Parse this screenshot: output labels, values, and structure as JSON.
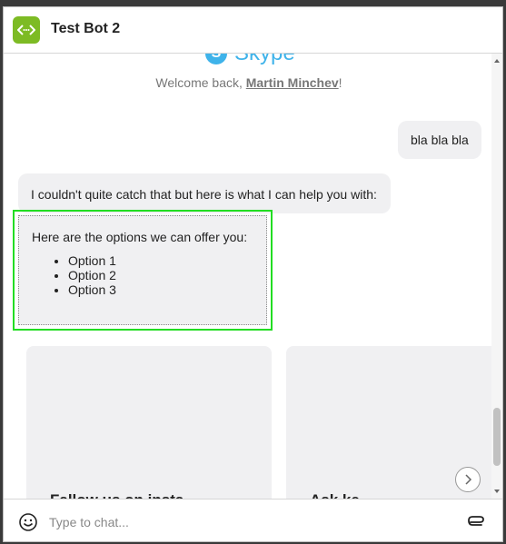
{
  "header": {
    "title": "Test Bot 2"
  },
  "welcome": {
    "brand": "Skype",
    "prefix": "Welcome back, ",
    "user_name": "Martin Minchev",
    "suffix": "!"
  },
  "messages": {
    "user_msg": "bla bla bla",
    "bot_msg1": "I couldn't quite catch that but here is what I can help you with:",
    "options_intro": "Here are the options we can offer you:",
    "options": [
      "Option 1",
      "Option 2",
      "Option 3"
    ]
  },
  "cards": [
    {
      "title": "Fallow us on insta"
    },
    {
      "title": "Ask ke"
    }
  ],
  "input": {
    "placeholder": "Type to chat..."
  },
  "colors": {
    "brand_green": "#7dbb24",
    "skype_blue": "#3fb3ea",
    "highlight": "#22dd22"
  }
}
